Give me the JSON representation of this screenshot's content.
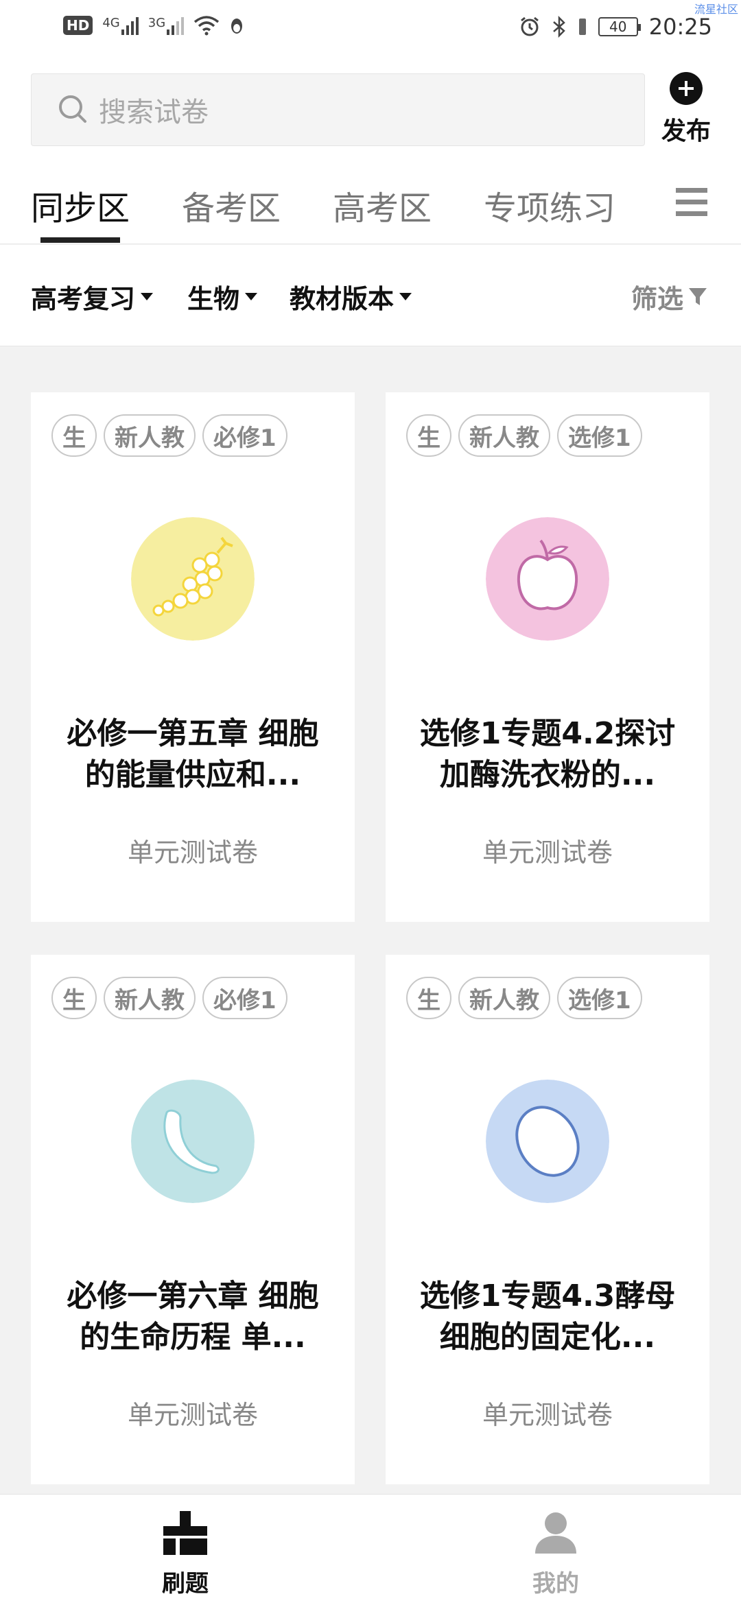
{
  "status_bar": {
    "hd": "HD",
    "sim1_net": "4G",
    "sim2_net": "3G",
    "battery": "40",
    "time": "20:25",
    "watermark": "流星社区"
  },
  "search": {
    "placeholder": "搜索试卷",
    "publish_label": "发布"
  },
  "tabs": [
    {
      "label": "同步区",
      "active": true
    },
    {
      "label": "备考区",
      "active": false
    },
    {
      "label": "高考区",
      "active": false
    },
    {
      "label": "专项练习",
      "active": false
    }
  ],
  "filters": {
    "review": "高考复习",
    "subject": "生物",
    "edition": "教材版本",
    "screen": "筛选"
  },
  "cards": [
    {
      "tags": [
        "生",
        "新人教",
        "必修1"
      ],
      "icon": "grapes-icon",
      "bg": "#f6eea0",
      "title_line1": "必修一第五章 细胞",
      "title_line2": "的能量供应和...",
      "subtitle": "单元测试卷"
    },
    {
      "tags": [
        "生",
        "新人教",
        "选修1"
      ],
      "icon": "apple-icon",
      "bg": "#f4c3df",
      "title_line1": "选修1专题4.2探讨",
      "title_line2": "加酶洗衣粉的...",
      "subtitle": "单元测试卷"
    },
    {
      "tags": [
        "生",
        "新人教",
        "必修1"
      ],
      "icon": "banana-icon",
      "bg": "#bfe3e6",
      "title_line1": "必修一第六章 细胞",
      "title_line2": "的生命历程 单...",
      "subtitle": "单元测试卷"
    },
    {
      "tags": [
        "生",
        "新人教",
        "选修1"
      ],
      "icon": "egg-icon",
      "bg": "#c6d9f4",
      "title_line1": "选修1专题4.3酵母",
      "title_line2": "细胞的固定化...",
      "subtitle": "单元测试卷"
    }
  ],
  "bottom_nav": {
    "practice": "刷题",
    "mine": "我的"
  },
  "colors": {
    "active": "#111111",
    "inactive": "#888888",
    "page_bg": "#f2f2f2"
  }
}
